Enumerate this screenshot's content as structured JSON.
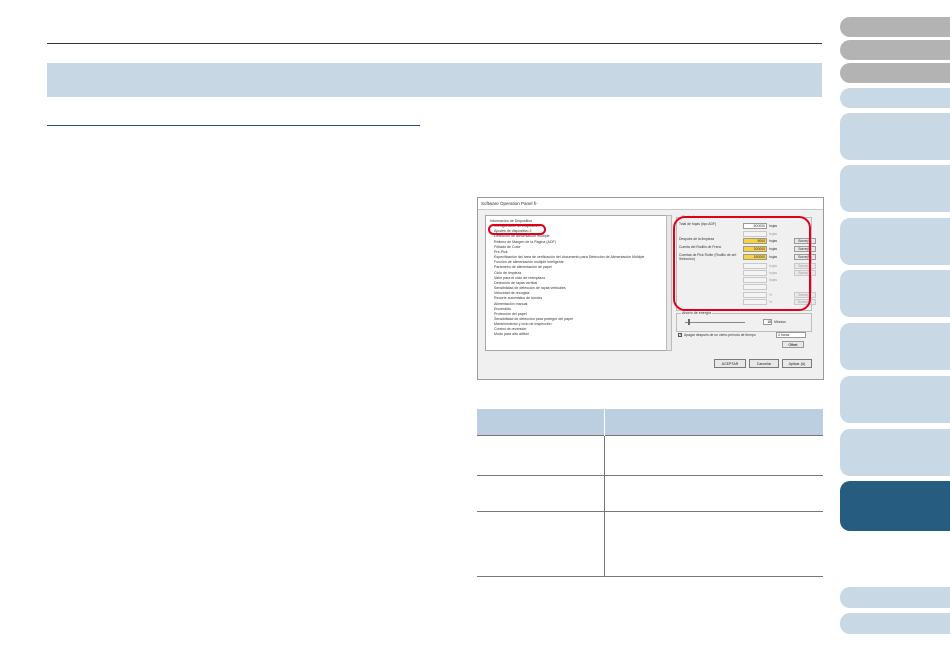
{
  "dialog": {
    "title": "Software Operation Panel fi-",
    "tree_items": [
      "Información de Dispositivo",
      "Configuración de Dispositivo",
      "Ajustes de dispositivo 2",
      "Detección de alimentación múltiple",
      "Relleno de Margen de la Página (ADF)",
      "Filtrado de Color",
      "Pre-Pick",
      "Especificación del área de verificación del documento para Detección de Alimentación Múltiple",
      "Función de alimentación múltiple inteligente",
      "Parámetro de alimentación de papel",
      "Ciclo de limpieza",
      "Valor para el ciclo de reemplazo",
      "Detección de rayas vertical",
      "Sensibilidad de detección de rayas verticales",
      "Velocidad de recogida",
      "Recorte automático de bordes",
      "Alimentación manual",
      "Encendido",
      "Protección del papel",
      "Sensibilidad de detección para proteger del papel",
      "Mantenimiento y ciclo de inspección",
      "Control de reversión",
      "Modo para alto altitud"
    ],
    "counter_group_label": "Contador",
    "counters": [
      {
        "label": "Total de hojas (tipo ADF)",
        "value": "500000",
        "unit": "hojas",
        "button": "",
        "highlight": false,
        "disabled": false
      },
      {
        "label": "",
        "value": "",
        "unit": "hojas",
        "button": "",
        "highlight": false,
        "disabled": true
      },
      {
        "label": "Después de la limpieza",
        "value": "5000",
        "unit": "hojas",
        "button": "Borrar(C)",
        "highlight": true,
        "disabled": false
      },
      {
        "label": "Cuenta del Rodillo de Freno",
        "value": "200000",
        "unit": "hojas",
        "button": "Borrar(B)",
        "highlight": true,
        "disabled": false
      },
      {
        "label": "Cuentas de Pick Roller (Rodillo de sel. Selección)",
        "value": "180000",
        "unit": "hojas",
        "button": "Borrar(R)",
        "highlight": true,
        "disabled": false
      },
      {
        "label": "",
        "value": "",
        "unit": "hojas",
        "button": "Borrar(X)",
        "highlight": false,
        "disabled": true
      },
      {
        "label": "",
        "value": "",
        "unit": "hojas",
        "button": "Borrar(Y)",
        "highlight": false,
        "disabled": true
      },
      {
        "label": "",
        "value": "",
        "unit": "hojas",
        "button": "",
        "highlight": false,
        "disabled": true
      },
      {
        "label": "",
        "value": "",
        "unit": "",
        "button": "",
        "highlight": false,
        "disabled": true
      },
      {
        "label": "",
        "value": "",
        "unit": "%",
        "button": "Borrar(Z)",
        "highlight": false,
        "disabled": true
      },
      {
        "label": "",
        "value": "",
        "unit": "%",
        "button": "Borrar(W)",
        "highlight": false,
        "disabled": true
      }
    ],
    "power_group_label": "Ahorro de energía",
    "power_value": "15",
    "power_unit": "Minutos",
    "power_checkbox_mark": "✓",
    "power_checkbox_text": "Apagar después de un cierto período de tiempo",
    "power_select_value": "4 horas",
    "offset_button": "Offset",
    "ok_button": "ACEPTAR",
    "cancel_button": "Cancelar",
    "apply_button": "Aplicar (A)"
  },
  "table": {
    "header": [
      "",
      ""
    ],
    "rows": [
      [
        "",
        ""
      ],
      [
        "",
        ""
      ],
      [
        "",
        ""
      ]
    ]
  },
  "colors": {
    "accent": "#265c80",
    "annotation": "#e0001a",
    "highlight_field": "#f8d23c"
  }
}
